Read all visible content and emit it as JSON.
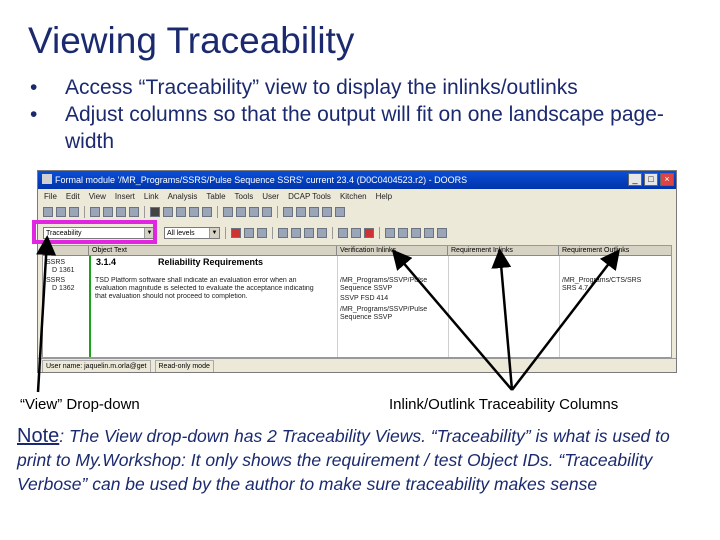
{
  "slide": {
    "title": "Viewing Traceability",
    "bullets": [
      "Access “Traceability” view to display the inlinks/outlinks",
      "Adjust columns so that the output will fit on one landscape page-width"
    ]
  },
  "window": {
    "title": "Formal module '/MR_Programs/SSRS/Pulse Sequence SSRS' current 23.4 (D0C0404523.r2) - DOORS",
    "menu": [
      "File",
      "Edit",
      "View",
      "Insert",
      "Link",
      "Analysis",
      "Table",
      "Tools",
      "User",
      "DCAP Tools",
      "Kitchen",
      "Help"
    ],
    "view_dropdown": "Traceability",
    "level_dropdown": "All levels"
  },
  "grid": {
    "headers": [
      "ID",
      "Object Text",
      "Verification Inlinks",
      "Requirement Inlinks",
      "Requirement Outlinks"
    ],
    "rows": [
      {
        "id_prefix": "SSRS",
        "id_num": "D 1361",
        "heading_num": "3.1.4",
        "heading_text": "Reliability Requirements"
      },
      {
        "id_prefix": "SSRS",
        "id_num": "D 1362",
        "text_lines": [
          "TSD Platform software shall indicate an evaluation error when an",
          "evaluation magnitude is selected to evaluate the acceptance indicating",
          "that evaluation should not proceed to completion."
        ],
        "verification": [
          "/MR_Programs/SSVP/Pulse",
          "Sequence SSVP",
          "SSVP FSD 414",
          "/MR_Programs/SSVP/Pulse",
          "Sequence SSVP"
        ],
        "outlinks": [
          "/MR_Programs/CTS/SRS",
          "SRS 4.7"
        ]
      }
    ]
  },
  "status": {
    "user": "User name: jaquelin.m.orla@get",
    "mode": "Read-only mode"
  },
  "callouts": {
    "view_dropdown": "“View” Drop-down",
    "columns": "Inlink/Outlink Traceability Columns"
  },
  "note": {
    "label": "Note",
    "text": ": The View drop-down has 2 Traceability Views.  “Traceability” is what is used to print to My.Workshop: It only shows the requirement / test Object IDs.  “Traceability Verbose” can be used by the author to make sure traceability makes sense"
  },
  "colors": {
    "title": "#1b2a6e",
    "highlight": "#e026e0",
    "titlebar": "#0a4fd6",
    "trace_bar": "#1aa31a"
  }
}
